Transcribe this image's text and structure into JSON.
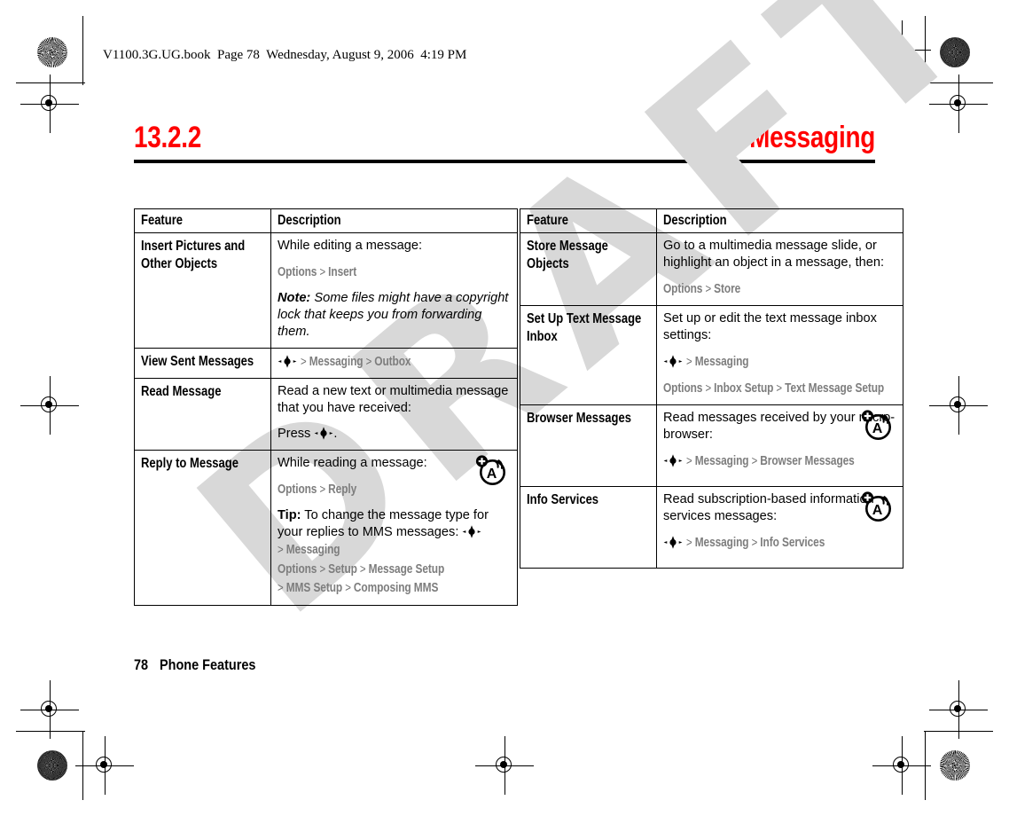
{
  "book_header": "V1100.3G.UG.book  Page 78  Wednesday, August 9, 2006  4:19 PM",
  "watermark": "DRAFT",
  "title": {
    "number": "13.2.2",
    "name": "Messaging",
    "color": "#ff0000"
  },
  "footer": {
    "page_number": "78",
    "section": "Phone Features"
  },
  "icons": {
    "nav_key": "nav-key-icon",
    "browser_a": "browser-message-icon"
  },
  "tables": [
    {
      "id": "left",
      "headers": [
        "Feature",
        "Description"
      ],
      "rows": [
        {
          "feature": "Insert Pictures and Other Objects",
          "blocks": [
            {
              "kind": "text",
              "text": "While editing a message:"
            },
            {
              "kind": "path",
              "path": "Options > Insert"
            },
            {
              "kind": "note",
              "label": "Note:",
              "text": " Some files might have a copyright lock that keeps you from forwarding them."
            }
          ],
          "icon": null
        },
        {
          "feature": "View Sent Messages",
          "blocks": [
            {
              "kind": "navpath",
              "path": "> Messaging > Outbox"
            }
          ],
          "icon": null
        },
        {
          "feature": "Read Message",
          "blocks": [
            {
              "kind": "text",
              "text": "Read a new text or multimedia message that you have received:"
            },
            {
              "kind": "press",
              "prefix": "Press ",
              "suffix": "."
            }
          ],
          "icon": null
        },
        {
          "feature": "Reply to Message",
          "blocks": [
            {
              "kind": "text",
              "text": "While reading a message:"
            },
            {
              "kind": "path",
              "path": "Options > Reply"
            },
            {
              "kind": "tip",
              "label": "Tip:",
              "text": " To change the message type for your replies to MMS messages: "
            },
            {
              "kind": "navinline",
              "path": "> Messaging"
            },
            {
              "kind": "path",
              "path": "Options > Setup > Message Setup"
            },
            {
              "kind": "path",
              "path": "> MMS Setup > Composing MMS"
            }
          ],
          "icon": "browser-message-icon"
        }
      ]
    },
    {
      "id": "right",
      "headers": [
        "Feature",
        "Description"
      ],
      "rows": [
        {
          "feature": "Store Message Objects",
          "blocks": [
            {
              "kind": "text",
              "text": "Go to a multimedia message slide, or highlight an object in a message, then:"
            },
            {
              "kind": "path",
              "path": "Options > Store"
            }
          ],
          "icon": null
        },
        {
          "feature": "Set Up Text Message Inbox",
          "blocks": [
            {
              "kind": "text",
              "text": "Set up or edit the text message inbox settings:"
            },
            {
              "kind": "navpath",
              "path": "> Messaging"
            },
            {
              "kind": "path",
              "path": "Options > Inbox Setup > Text Message Setup"
            }
          ],
          "icon": null
        },
        {
          "feature": "Browser Messages",
          "blocks": [
            {
              "kind": "text",
              "text": "Read messages received by your micro-browser:"
            },
            {
              "kind": "navpath",
              "path": "> Messaging > Browser Messages"
            }
          ],
          "icon": "browser-message-icon"
        },
        {
          "feature": "Info Services",
          "blocks": [
            {
              "kind": "text",
              "text": "Read subscription-based information services messages:"
            },
            {
              "kind": "navpath",
              "path": "> Messaging > Info Services"
            }
          ],
          "icon": "browser-message-icon"
        }
      ]
    }
  ]
}
